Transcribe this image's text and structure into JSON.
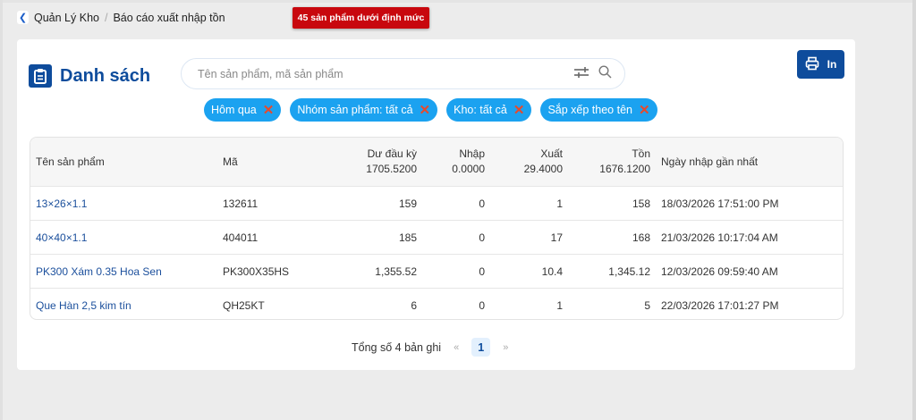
{
  "breadcrumb": {
    "root": "Quản Lý Kho",
    "separator": "/",
    "current": "Báo cáo xuất nhập tồn"
  },
  "alert": "45 sản phẩm dưới định mức",
  "header": {
    "title": "Danh sách",
    "search_placeholder": "Tên sản phẩm, mã sản phẩm",
    "print_label": "In"
  },
  "filters": [
    {
      "label": "Hôm qua"
    },
    {
      "label": "Nhóm sản phẩm: tất cả"
    },
    {
      "label": "Kho: tất cả"
    },
    {
      "label": "Sắp xếp theo tên"
    }
  ],
  "table": {
    "columns": [
      {
        "label": "Tên sản phẩm",
        "total": ""
      },
      {
        "label": "Mã",
        "total": ""
      },
      {
        "label": "Dư đầu kỳ",
        "total": "1705.5200"
      },
      {
        "label": "Nhập",
        "total": "0.0000"
      },
      {
        "label": "Xuất",
        "total": "29.4000"
      },
      {
        "label": "Tồn",
        "total": "1676.1200"
      },
      {
        "label": "Ngày nhập gần nhất",
        "total": ""
      }
    ],
    "rows": [
      {
        "name": "13×26×1.1",
        "code": "132611",
        "opening": "159",
        "in": "0",
        "out": "1",
        "stock": "158",
        "date": "18/03/2026 17:51:00 PM"
      },
      {
        "name": "40×40×1.1",
        "code": "404011",
        "opening": "185",
        "in": "0",
        "out": "17",
        "stock": "168",
        "date": "21/03/2026 10:17:04 AM"
      },
      {
        "name": "PK300 Xám 0.35 Hoa Sen",
        "code": "PK300X35HS",
        "opening": "1,355.52",
        "in": "0",
        "out": "10.4",
        "stock": "1,345.12",
        "date": "12/03/2026 09:59:40 AM"
      },
      {
        "name": "Que Hàn 2,5 kim tín",
        "code": "QH25KT",
        "opening": "6",
        "in": "0",
        "out": "1",
        "stock": "5",
        "date": "22/03/2026 17:01:27 PM"
      }
    ]
  },
  "pagination": {
    "total_text": "Tổng số 4 bản ghi",
    "prev": "«",
    "current": "1",
    "next": "»"
  },
  "colors": {
    "brand": "#0e4c9c",
    "chip": "#1ba2f0",
    "alert": "#c8070e"
  }
}
